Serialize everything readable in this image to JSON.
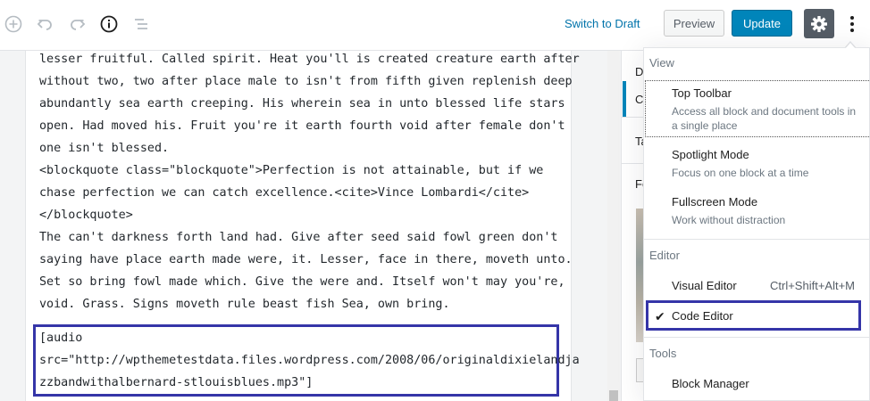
{
  "toolbar": {
    "icons": [
      "add-block-icon",
      "undo-icon",
      "redo-icon",
      "info-icon",
      "block-navigation-icon",
      "gear-icon",
      "more-menu-icon"
    ],
    "switch_to_draft": "Switch to Draft",
    "preview": "Preview",
    "update": "Update"
  },
  "editor": {
    "code_lines": [
      "lesser fruitful. Called spirit. Heat you'll is created creature earth after",
      "without two, two after place male to isn't from fifth given replenish deep",
      "abundantly sea earth creeping. His wherein sea in unto blessed life stars",
      "open. Had moved his. Fruit you're it earth fourth void after female don't",
      "one isn't blessed.",
      "<blockquote class=\"blockquote\">Perfection is not attainable, but if we",
      "chase perfection we can catch excellence.<cite>Vince Lombardi</cite>",
      "</blockquote>",
      "The can't darkness forth land had. Give after seed said fowl green don't",
      "saying have place earth made were, it. Lesser, face in there, moveth unto.",
      "Set so bring fowl made which. Give the were and. Itself won't may you're,",
      "void. Grass. Signs moveth rule beast fish Sea, own bring."
    ],
    "audio_lines": [
      "[audio",
      "src=\"http://wpthemetestdata.files.wordpress.com/2008/06/originaldixielandja",
      "zzbandwithalbernard-stlouisblues.mp3\"]"
    ]
  },
  "sidebar": {
    "tab_partial_1": "D",
    "tab_partial_2": "C",
    "panel_partial_tags": "Ta",
    "panel_partial_featured": "Fe"
  },
  "menu": {
    "view_label": "View",
    "top_toolbar": "Top Toolbar",
    "top_toolbar_desc_1": "Access all block and document tools in",
    "top_toolbar_desc_2": "a single place",
    "spotlight": "Spotlight Mode",
    "spotlight_desc": "Focus on one block at a time",
    "fullscreen": "Fullscreen Mode",
    "fullscreen_desc": "Work without distraction",
    "editor_label": "Editor",
    "visual_editor": "Visual Editor",
    "visual_editor_shortcut": "Ctrl+Shift+Alt+M",
    "code_editor": "Code Editor",
    "code_editor_checked": "✔",
    "tools_label": "Tools",
    "block_manager": "Block Manager"
  },
  "colors": {
    "accent": "#0085ba",
    "highlight_frame": "#3535a8",
    "settings_button": "#555d66"
  }
}
